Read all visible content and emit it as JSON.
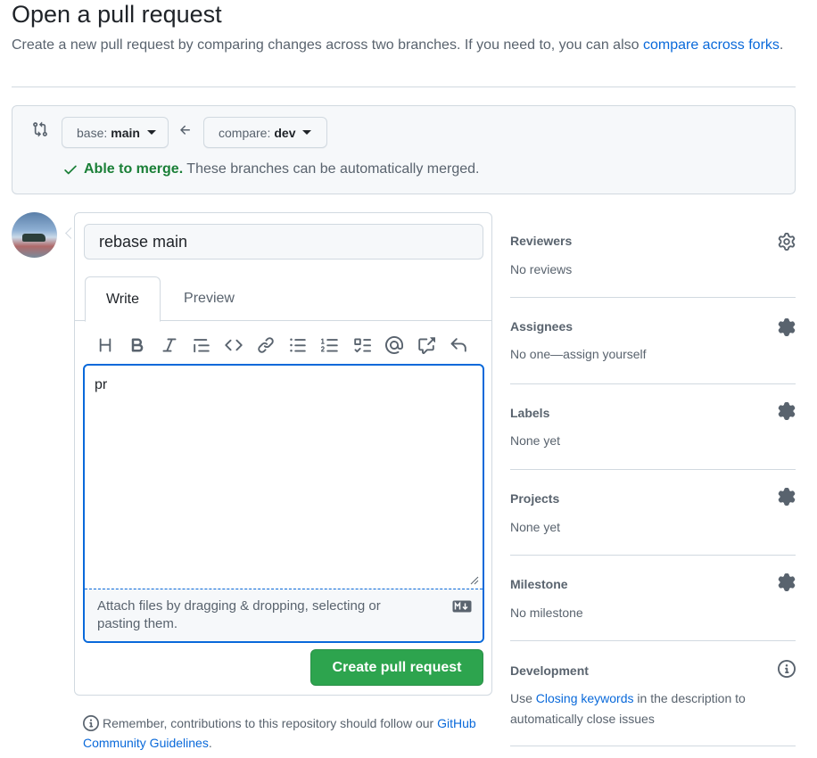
{
  "page": {
    "title": "Open a pull request",
    "subtitle_text": "Create a new pull request by comparing changes across two branches. If you need to, you can also",
    "subtitle_link": "compare across forks",
    "subtitle_end": "."
  },
  "range": {
    "base_prefix": "base:",
    "base_branch": "main",
    "compare_prefix": "compare:",
    "compare_branch": "dev",
    "merge_ok": "Able to merge.",
    "merge_text": "These branches can be automatically merged."
  },
  "composer": {
    "title_value": "rebase main",
    "tabs": [
      "Write",
      "Preview"
    ],
    "body_value": "pr",
    "attach_text": "Attach files by dragging & dropping, selecting or pasting them.",
    "submit_label": "Create pull request",
    "toolbar_icons": [
      "heading-icon",
      "bold-icon",
      "italic-icon",
      "quote-icon",
      "code-icon",
      "link-icon",
      "unordered-list-icon",
      "ordered-list-icon",
      "task-list-icon",
      "mention-icon",
      "cross-reference-icon",
      "undo-icon"
    ]
  },
  "guidelines": {
    "text": "Remember, contributions to this repository should follow our",
    "link": "GitHub Community Guidelines",
    "end": "."
  },
  "sidebar": {
    "reviewers": {
      "heading": "Reviewers",
      "value": "No reviews"
    },
    "assignees": {
      "heading": "Assignees",
      "value": "No one—assign yourself"
    },
    "labels": {
      "heading": "Labels",
      "value": "None yet"
    },
    "projects": {
      "heading": "Projects",
      "value": "None yet"
    },
    "milestone": {
      "heading": "Milestone",
      "value": "No milestone"
    },
    "development": {
      "heading": "Development",
      "value_pre": "Use",
      "value_link": "Closing keywords",
      "value_post": "in the description to automatically close issues"
    }
  },
  "colors": {
    "link": "#0969da",
    "success": "#1a7f37",
    "primary_button": "#2da44e",
    "focus_border": "#0969da",
    "muted_text": "#59636e",
    "border": "#d1d9e0"
  }
}
